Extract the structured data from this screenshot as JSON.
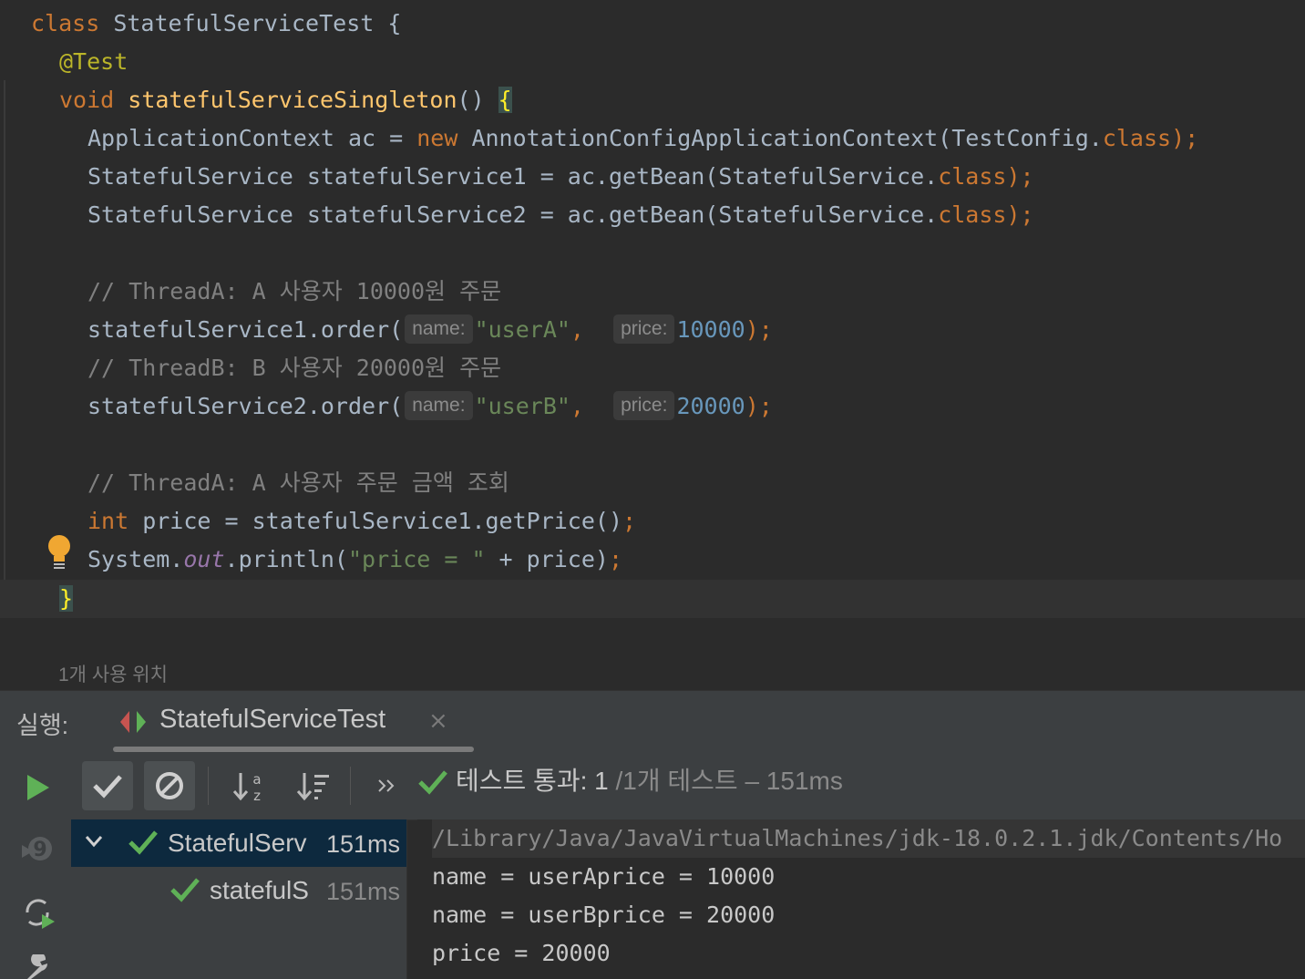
{
  "editor": {
    "lines": {
      "l1_kw": "class",
      "l1_rest": " StatefulServiceTest {",
      "l2_ann": "@Test",
      "l3_kw": "void",
      "l3_fn": "statefulServiceSingleton",
      "l3_paren": "() ",
      "l3_brace": "{",
      "l4_a": "ApplicationContext ac = ",
      "l4_new": "new",
      "l4_b": " AnnotationConfigApplicationContext(TestConfig.",
      "l4_cls": "class",
      "l4_end": ");",
      "l5_a": "StatefulService statefulService1 = ac.getBean(StatefulService.",
      "l5_cls": "class",
      "l5_end": ");",
      "l6_a": "StatefulService statefulService2 = ac.getBean(StatefulService.",
      "l6_cls": "class",
      "l6_end": ");",
      "l8_cmt": "// ThreadA: A 사용자 10000원 주문",
      "l9_a": "statefulService1.order(",
      "l9_hint_name": "name:",
      "l9_str": "\"userA\"",
      "l9_comma": ",",
      "l9_hint_price": "price:",
      "l9_num": "10000",
      "l9_end": ");",
      "l10_cmt": "// ThreadB: B 사용자 20000원 주문",
      "l11_a": "statefulService2.order(",
      "l11_hint_name": "name:",
      "l11_str": "\"userB\"",
      "l11_comma": ",",
      "l11_hint_price": "price:",
      "l11_num": "20000",
      "l11_end": ");",
      "l13_cmt": "// ThreadA: A 사용자 주문 금액 조회",
      "l14_kw": "int",
      "l14_rest": " price = statefulService1.getPrice()",
      "l14_end": ";",
      "l15_a": "System.",
      "l15_out": "out",
      "l15_b": ".println(",
      "l15_str": "\"price = \"",
      "l15_c": " + price)",
      "l15_end": ";",
      "l16_brace": "}"
    },
    "usages_hint": "1개 사용 위치"
  },
  "run_panel": {
    "label": "실행:",
    "tab_title": "StatefulServiceTest",
    "tab_close": "×",
    "status_main": "테스트 통과: 1",
    "status_muted": " /1개 테스트 – 151ms",
    "tree": [
      {
        "label": "StatefulServ",
        "time": "151ms"
      },
      {
        "label": "statefulS",
        "time": "151ms"
      }
    ],
    "console": [
      "/Library/Java/JavaVirtualMachines/jdk-18.0.2.1.jdk/Contents/Ho",
      "name = userAprice = 10000",
      "name = userBprice = 20000",
      "price = 20000"
    ]
  },
  "colors": {
    "keyword": "#cc7832",
    "annotation": "#bbb529",
    "method": "#ffc66d",
    "string": "#6a8759",
    "number": "#6897bb",
    "comment": "#808080",
    "pass_green": "#5fb157",
    "selection": "#0d293e"
  },
  "icons": [
    "bulb-icon",
    "run-tab-icon",
    "rerun-icon",
    "rerun-failed-icon",
    "toggle-auto-test-icon",
    "settings-icon",
    "show-passed-icon",
    "show-ignored-icon",
    "sort-alpha-icon",
    "sort-duration-icon",
    "more-icon",
    "check-icon",
    "chevron-down-icon"
  ]
}
